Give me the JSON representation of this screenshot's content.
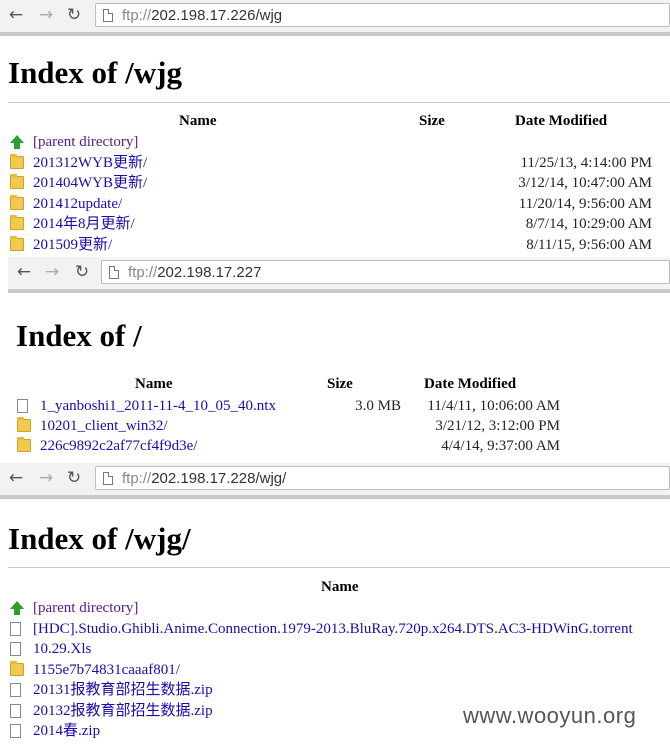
{
  "window1": {
    "address": {
      "proto": "ftp://",
      "host": "202.198.17.226/wjg"
    },
    "title": "Index of /wjg",
    "headers": {
      "name": "Name",
      "size": "Size",
      "date": "Date Modified"
    },
    "rows": [
      {
        "icon": "up",
        "name": "[parent directory]",
        "size": "",
        "date": ""
      },
      {
        "icon": "folder",
        "name": "201312WYB更新/",
        "size": "",
        "date": "11/25/13, 4:14:00 PM"
      },
      {
        "icon": "folder",
        "name": "201404WYB更新/",
        "size": "",
        "date": "3/12/14, 10:47:00 AM"
      },
      {
        "icon": "folder",
        "name": "201412update/",
        "size": "",
        "date": "11/20/14, 9:56:00 AM"
      },
      {
        "icon": "folder",
        "name": "2014年8月更新/",
        "size": "",
        "date": "8/7/14, 10:29:00 AM"
      },
      {
        "icon": "folder",
        "name": "201509更新/",
        "size": "",
        "date": "8/11/15, 9:56:00 AM"
      }
    ]
  },
  "window2": {
    "address": {
      "proto": "ftp://",
      "host": "202.198.17.227"
    },
    "title": "Index of /",
    "headers": {
      "name": "Name",
      "size": "Size",
      "date": "Date Modified"
    },
    "rows": [
      {
        "icon": "file",
        "name": "1_yanboshi1_2011-11-4_10_05_40.ntx",
        "size": "3.0 MB",
        "date": "11/4/11, 10:06:00 AM"
      },
      {
        "icon": "folder",
        "name": "10201_client_win32/",
        "size": "",
        "date": "3/21/12, 3:12:00 PM"
      },
      {
        "icon": "folder",
        "name": "226c9892c2af77cf4f9d3e/",
        "size": "",
        "date": "4/4/14, 9:37:00 AM"
      }
    ]
  },
  "window3": {
    "address": {
      "proto": "ftp://",
      "host": "202.198.17.228/wjg/"
    },
    "title": "Index of /wjg/",
    "headers": {
      "name": "Name"
    },
    "rows": [
      {
        "icon": "up",
        "name": "[parent directory]"
      },
      {
        "icon": "file",
        "name": "[HDC].Studio.Ghibli.Anime.Connection.1979-2013.BluRay.720p.x264.DTS.AC3-HDWinG.torrent"
      },
      {
        "icon": "file",
        "name": "10.29.Xls"
      },
      {
        "icon": "folder",
        "name": "1155e7b74831caaaf801/"
      },
      {
        "icon": "file",
        "name": "20131报教育部招生数据.zip"
      },
      {
        "icon": "file",
        "name": "20132报教育部招生数据.zip"
      },
      {
        "icon": "file",
        "name": "2014春.zip"
      }
    ]
  },
  "watermark": "www.wooyun.org"
}
